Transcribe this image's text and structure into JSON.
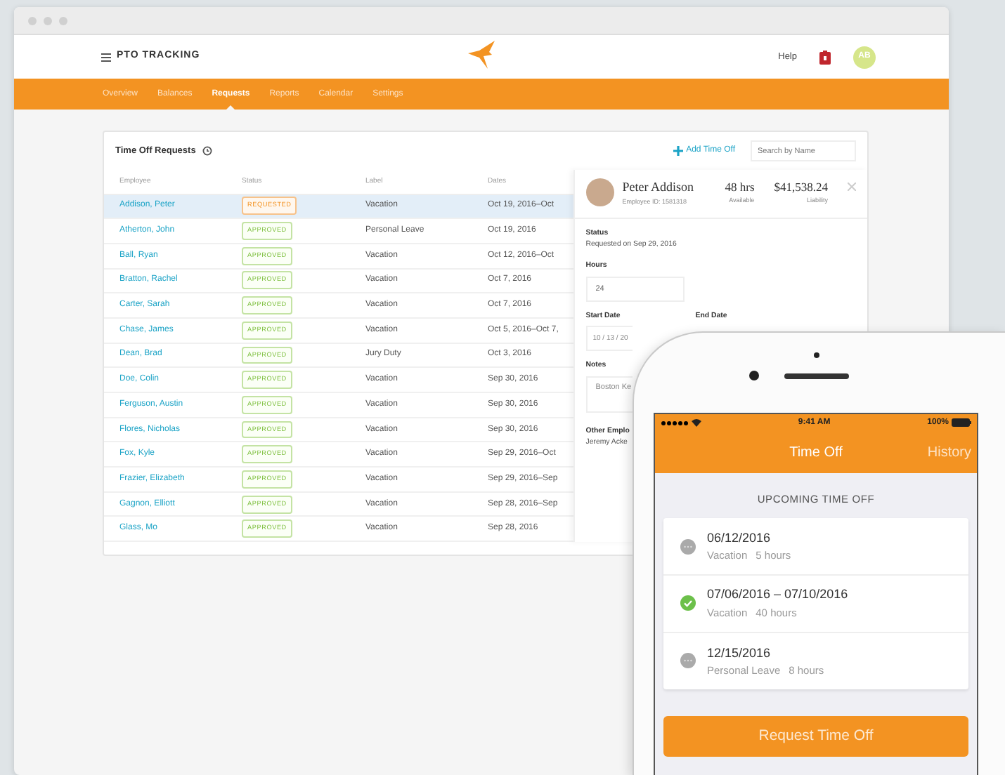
{
  "browser": {
    "app_title": "PTO TRACKING",
    "help": "Help",
    "avatar_initials": "AB",
    "nav": [
      {
        "label": "Overview",
        "selected": false
      },
      {
        "label": "Balances",
        "selected": false
      },
      {
        "label": "Requests",
        "selected": true
      },
      {
        "label": "Reports",
        "selected": false
      },
      {
        "label": "Calendar",
        "selected": false
      },
      {
        "label": "Settings",
        "selected": false
      }
    ]
  },
  "requests": {
    "title": "Time Off Requests",
    "add_label": "Add Time Off",
    "search": {
      "placeholder": "Search by Name"
    },
    "columns": [
      "Employee",
      "Status",
      "Label",
      "Dates"
    ],
    "rows": [
      {
        "employee": "Addison, Peter",
        "status": "REQUESTED",
        "kind": "requested",
        "label": "Vacation",
        "dates": "Oct 19, 2016–Oct",
        "selected": true
      },
      {
        "employee": "Atherton, John",
        "status": "APPROVED",
        "kind": "approved",
        "label": "Personal Leave",
        "dates": "Oct 19, 2016",
        "selected": false
      },
      {
        "employee": "Ball, Ryan",
        "status": "APPROVED",
        "kind": "approved",
        "label": "Vacation",
        "dates": "Oct 12, 2016–Oct",
        "selected": false
      },
      {
        "employee": "Bratton, Rachel",
        "status": "APPROVED",
        "kind": "approved",
        "label": "Vacation",
        "dates": "Oct 7, 2016",
        "selected": false
      },
      {
        "employee": "Carter, Sarah",
        "status": "APPROVED",
        "kind": "approved",
        "label": "Vacation",
        "dates": "Oct 7, 2016",
        "selected": false
      },
      {
        "employee": "Chase, James",
        "status": "APPROVED",
        "kind": "approved",
        "label": "Vacation",
        "dates": "Oct 5, 2016–Oct 7,",
        "selected": false
      },
      {
        "employee": "Dean, Brad",
        "status": "APPROVED",
        "kind": "approved",
        "label": "Jury Duty",
        "dates": "Oct 3, 2016",
        "selected": false
      },
      {
        "employee": "Doe, Colin",
        "status": "APPROVED",
        "kind": "approved",
        "label": "Vacation",
        "dates": "Sep 30, 2016",
        "selected": false
      },
      {
        "employee": "Ferguson, Austin",
        "status": "APPROVED",
        "kind": "approved",
        "label": "Vacation",
        "dates": "Sep 30, 2016",
        "selected": false
      },
      {
        "employee": "Flores, Nicholas",
        "status": "APPROVED",
        "kind": "approved",
        "label": "Vacation",
        "dates": "Sep 30, 2016",
        "selected": false
      },
      {
        "employee": "Fox, Kyle",
        "status": "APPROVED",
        "kind": "approved",
        "label": "Vacation",
        "dates": "Sep 29, 2016–Oct",
        "selected": false
      },
      {
        "employee": "Frazier, Elizabeth",
        "status": "APPROVED",
        "kind": "approved",
        "label": "Vacation",
        "dates": "Sep 29, 2016–Sep",
        "selected": false
      },
      {
        "employee": "Gagnon, Elliott",
        "status": "APPROVED",
        "kind": "approved",
        "label": "Vacation",
        "dates": "Sep 28, 2016–Sep",
        "selected": false
      },
      {
        "employee": "Glass, Mo",
        "status": "APPROVED",
        "kind": "approved",
        "label": "Vacation",
        "dates": "Sep 28, 2016",
        "selected": false
      }
    ]
  },
  "detail": {
    "name": "Peter Addison",
    "employee_id": "Employee ID: 1581318",
    "stats": [
      {
        "value": "48 hrs",
        "caption": "Available"
      },
      {
        "value": "$41,538.24",
        "caption": "Liability"
      }
    ],
    "status_label": "Status",
    "status_text": "Requested on Sep 29, 2016",
    "hours": {
      "label": "Hours",
      "value": "24"
    },
    "start_date": {
      "label": "Start Date",
      "value": "10 / 13 / 20"
    },
    "end_date": {
      "label": "End Date"
    },
    "notes": {
      "label": "Notes",
      "value": "Boston Ke"
    },
    "other": {
      "label": "Other Emplo",
      "value": "Jeremy Acke"
    }
  },
  "phone": {
    "time": "9:41 AM",
    "battery": "100%",
    "title": "Time Off",
    "history": "History",
    "section": "UPCOMING TIME OFF",
    "items": [
      {
        "date": "06/12/2016",
        "label": "Vacation",
        "hours": "5 hours",
        "kind": "pending"
      },
      {
        "date": "07/06/2016 – 07/10/2016",
        "label": "Vacation",
        "hours": "40 hours",
        "kind": "approved"
      },
      {
        "date": "12/15/2016",
        "label": "Personal Leave",
        "hours": "8 hours",
        "kind": "pending"
      }
    ],
    "button": "Request Time Off"
  }
}
